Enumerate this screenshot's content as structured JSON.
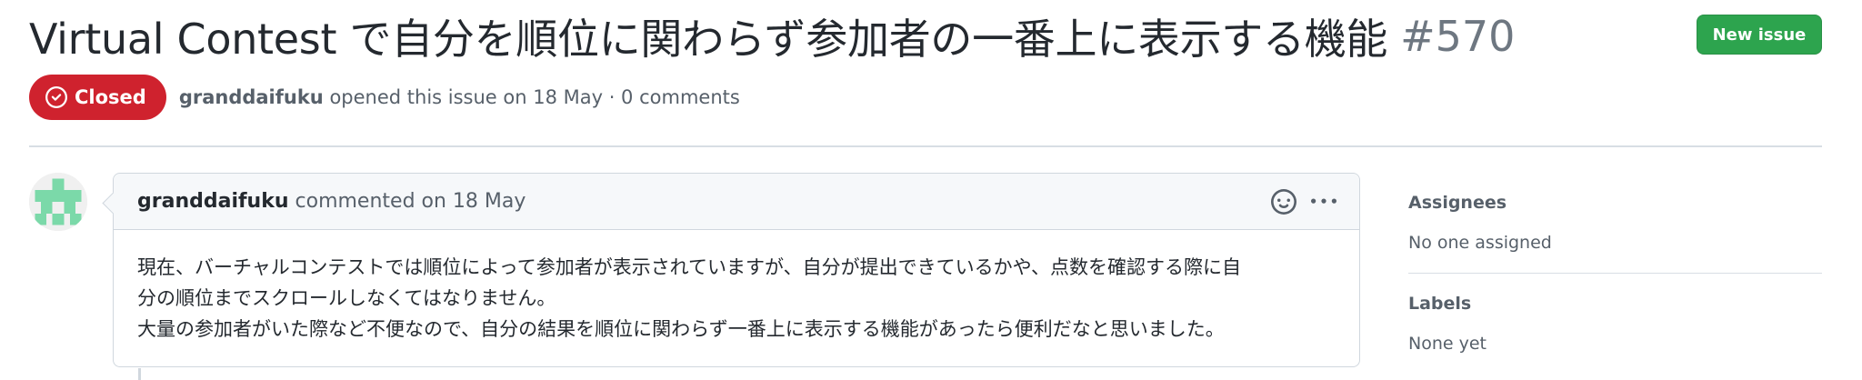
{
  "issue": {
    "title": "Virtual Contest で自分を順位に関わらず参加者の一番上に表示する機能",
    "number": "#570",
    "new_issue_label": "New issue",
    "state_label": "Closed",
    "state_color": "#cf222e",
    "author": "granddaifuku",
    "meta_text": " opened this issue on 18 May · 0 comments"
  },
  "comment": {
    "author": "granddaifuku",
    "action_text": " commented on 18 May",
    "body_line_1": "現在、バーチャルコンテストでは順位によって参加者が表示されていますが、自分が提出できているかや、点数を確認する際に自",
    "body_line_2": "分の順位までスクロールしなくてはなりません。",
    "body_line_3": "大量の参加者がいた際など不便なので、自分の結果を順位に関わらず一番上に表示する機能があったら便利だなと思いました。"
  },
  "sidebar": {
    "assignees_heading": "Assignees",
    "assignees_value": "No one assigned",
    "labels_heading": "Labels",
    "labels_value": "None yet"
  },
  "icons": {
    "state": "issue-closed-icon",
    "reaction": "smiley-icon",
    "menu": "kebab-horizontal-icon"
  },
  "colors": {
    "primary_button": "#2da44e",
    "closed": "#cf222e",
    "avatar_identicon": "#7bd9a9"
  }
}
